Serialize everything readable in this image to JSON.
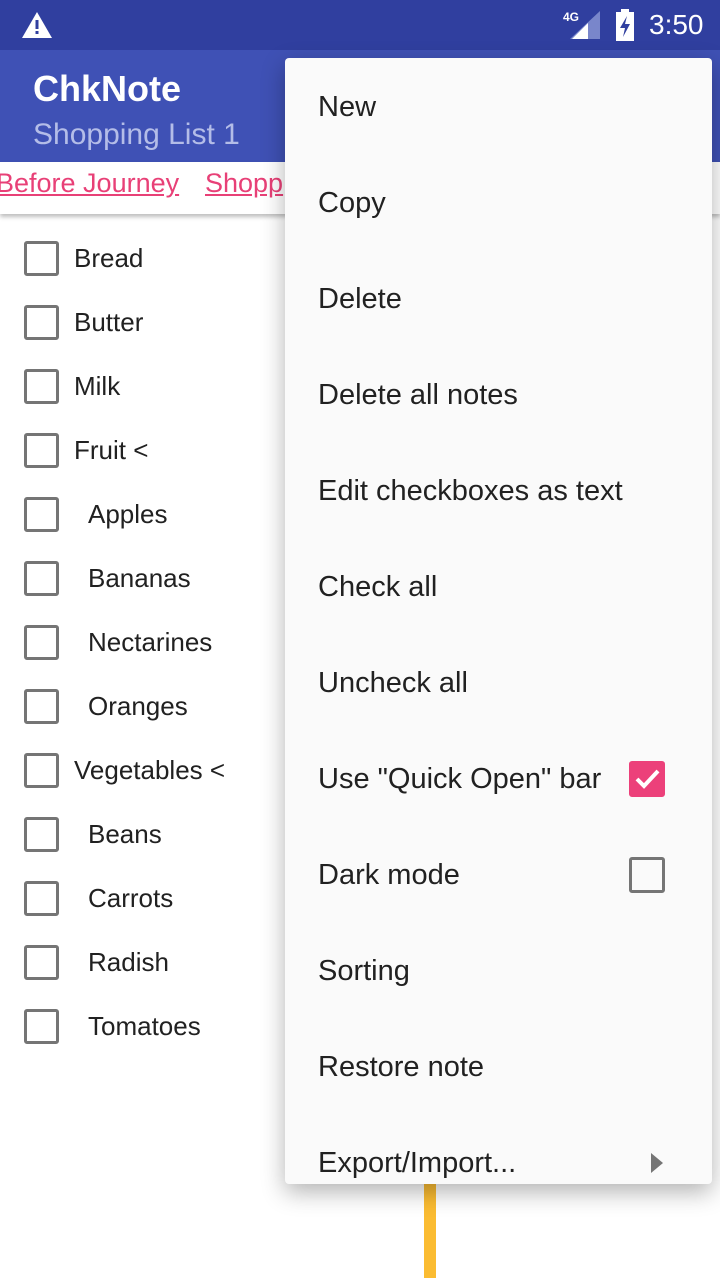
{
  "status_bar": {
    "time": "3:50",
    "network": "4G",
    "icons": [
      "warning-icon",
      "signal-icon",
      "battery-charging-icon"
    ]
  },
  "app_bar": {
    "title": "ChkNote",
    "subtitle": "Shopping List 1"
  },
  "quick_open": {
    "tabs": [
      "Before Journey",
      "Shopp"
    ]
  },
  "checklist": [
    {
      "label": "Bread",
      "indent": false,
      "checked": false
    },
    {
      "label": "Butter",
      "indent": false,
      "checked": false
    },
    {
      "label": "Milk",
      "indent": false,
      "checked": false
    },
    {
      "label": "Fruit <",
      "indent": false,
      "checked": false
    },
    {
      "label": "Apples",
      "indent": true,
      "checked": false
    },
    {
      "label": "Bananas",
      "indent": true,
      "checked": false
    },
    {
      "label": "Nectarines",
      "indent": true,
      "checked": false
    },
    {
      "label": "Oranges",
      "indent": true,
      "checked": false
    },
    {
      "label": "Vegetables <",
      "indent": false,
      "checked": false
    },
    {
      "label": "Beans",
      "indent": true,
      "checked": false
    },
    {
      "label": "Carrots",
      "indent": true,
      "checked": false
    },
    {
      "label": "Radish",
      "indent": true,
      "checked": false
    },
    {
      "label": "Tomatoes",
      "indent": true,
      "checked": false
    }
  ],
  "menu": [
    {
      "label": "New"
    },
    {
      "label": "Copy"
    },
    {
      "label": "Delete"
    },
    {
      "label": "Delete all notes"
    },
    {
      "label": "Edit checkboxes as text"
    },
    {
      "label": "Check all"
    },
    {
      "label": "Uncheck all"
    },
    {
      "label": "Use \"Quick Open\" bar",
      "checkbox": true,
      "checked": true
    },
    {
      "label": "Dark mode",
      "checkbox": true,
      "checked": false
    },
    {
      "label": "Sorting"
    },
    {
      "label": "Restore note"
    },
    {
      "label": "Export/Import...",
      "submenu": true
    }
  ],
  "colors": {
    "status": "#303f9f",
    "primary": "#3f51b5",
    "accent": "#ec407a",
    "cursor": "#fbbc32"
  }
}
